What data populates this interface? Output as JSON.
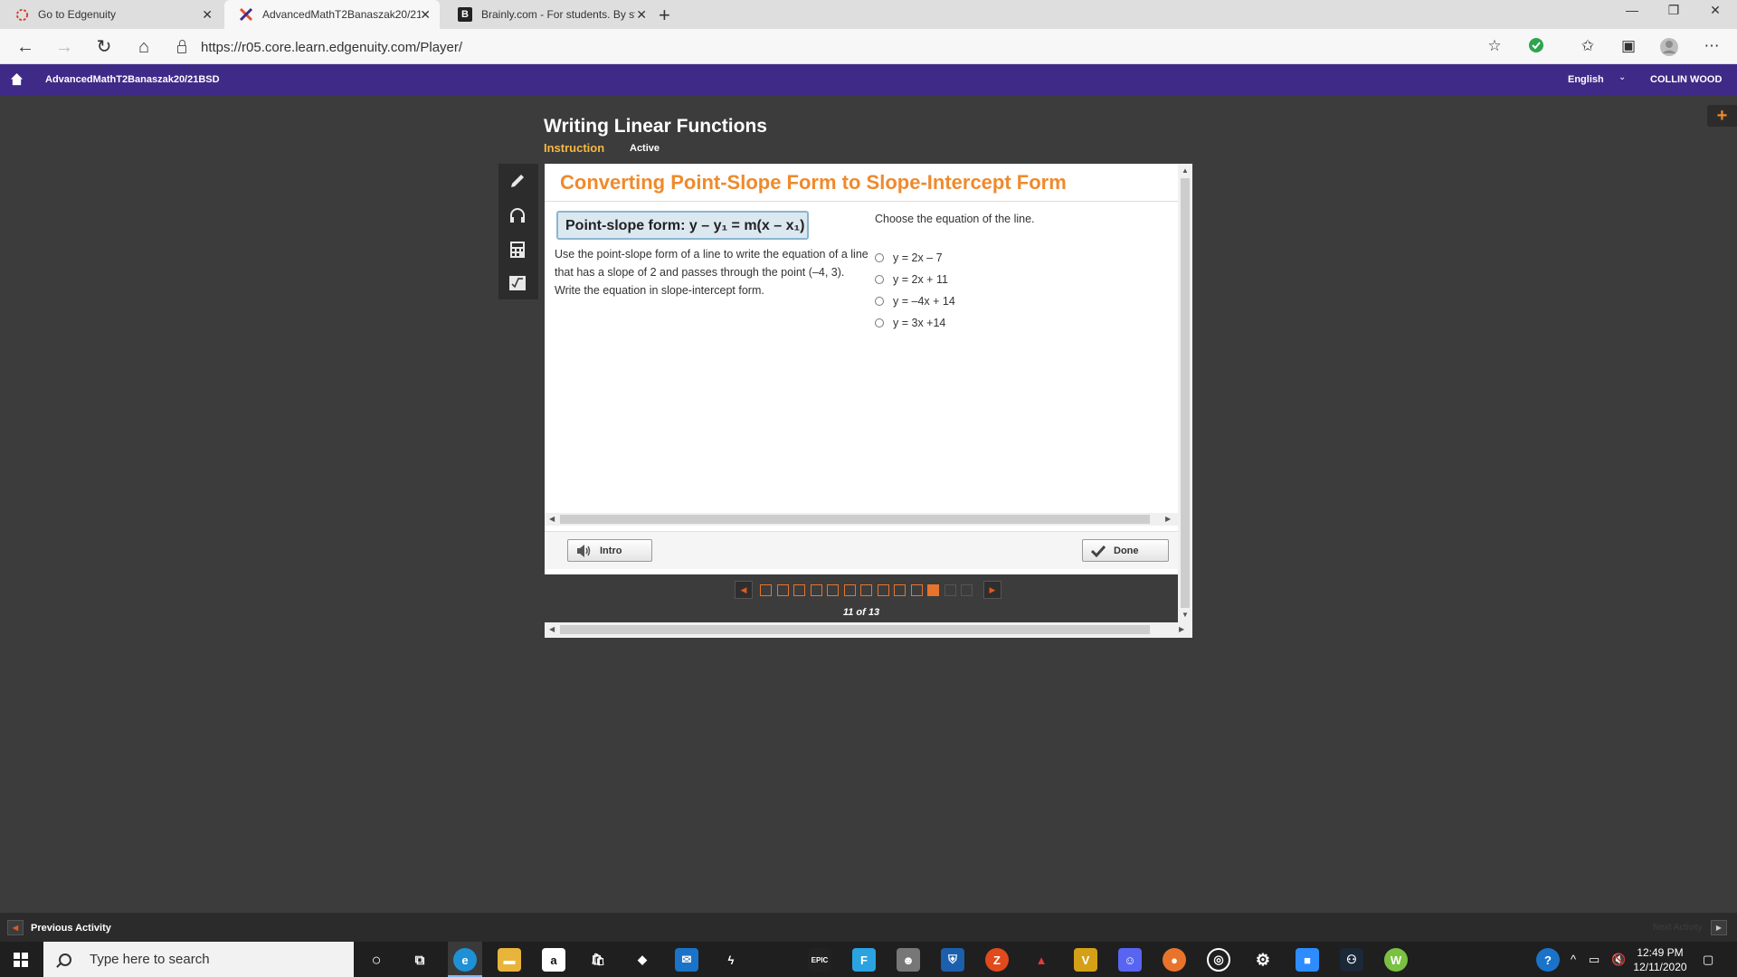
{
  "browser": {
    "tabs": [
      {
        "label": "Go to Edgenuity",
        "icon": "edgenuity-ring-icon"
      },
      {
        "label": "AdvancedMathT2Banaszak20/21",
        "icon": "edgenuity-x-icon"
      },
      {
        "label": "Brainly.com - For students. By stu",
        "icon": "brainly-icon"
      }
    ],
    "url": "https://r05.core.learn.edgenuity.com/Player/"
  },
  "edgenuity": {
    "course": "AdvancedMathT2Banaszak20/21BSD",
    "language": "English",
    "user": "COLLIN WOOD"
  },
  "lesson": {
    "title": "Writing Linear Functions",
    "type": "Instruction",
    "status": "Active"
  },
  "content": {
    "heading": "Converting Point-Slope Form to Slope-Intercept Form",
    "formula": "Point-slope form: y – y₁ = m(x – x₁)",
    "prompt": "Use the point-slope form of a line to write the equation of a line that has a slope of 2 and passes through the point (–4, 3). Write the equation in slope-intercept form.",
    "question": "Choose the equation of the line.",
    "options": [
      "y = 2x – 7",
      "y = 2x + 11",
      "y = –4x + 14",
      "y = 3x +14"
    ],
    "intro_label": "Intro",
    "done_label": "Done"
  },
  "pager": {
    "count_text": "11 of 13",
    "total": 13,
    "current": 11,
    "available": 11
  },
  "footer": {
    "previous_activity": "Previous Activity",
    "next_activity": "Next Activity"
  },
  "taskbar": {
    "search_placeholder": "Type here to search",
    "time": "12:49 PM",
    "date": "12/11/2020"
  },
  "colors": {
    "edgenuity_purple": "#3f2a87",
    "accent_orange": "#ef8a2c",
    "instruction_yellow": "#f5b941"
  }
}
